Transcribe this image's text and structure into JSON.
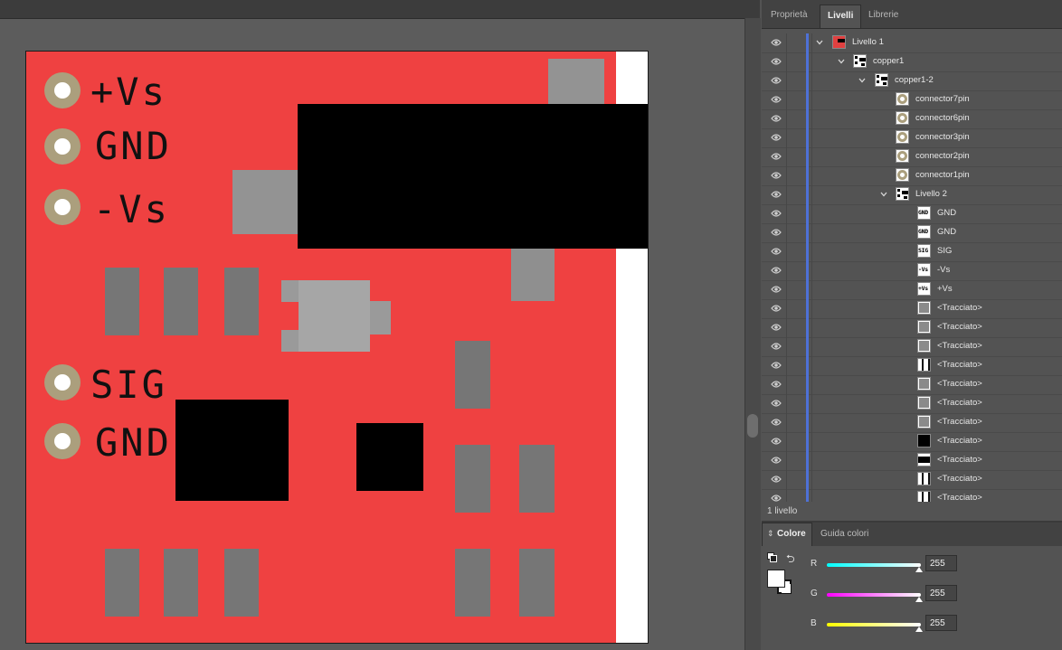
{
  "canvas": {
    "silkscreen_labels": [
      "+Vs",
      "GND",
      "-Vs",
      "SIG",
      "GND"
    ],
    "colors": {
      "board": "#ef4141",
      "pad": "#767676",
      "pad_light": "#939393",
      "ic": "#000000",
      "hole_ring": "#ab9f7d",
      "silk": "#111111"
    }
  },
  "panel": {
    "tabs": [
      "Proprietà",
      "Livelli",
      "Librerie"
    ],
    "active_tab": "Livelli",
    "layers": [
      {
        "name": "Livello 1",
        "icon": "artwork-thumb-red"
      },
      {
        "name": "copper1",
        "icon": "artwork-thumb"
      },
      {
        "name": "copper1-2",
        "icon": "artwork-thumb"
      },
      {
        "name": "connector7pin",
        "icon": "pin-thumb"
      },
      {
        "name": "connector6pin",
        "icon": "pin-thumb"
      },
      {
        "name": "connector3pin",
        "icon": "pin-thumb"
      },
      {
        "name": "connector2pin",
        "icon": "pin-thumb"
      },
      {
        "name": "connector1pin",
        "icon": "pin-thumb"
      },
      {
        "name": "Livello 2",
        "icon": "artwork-thumb"
      },
      {
        "name": "GND",
        "icon": "text-thumb",
        "thumb_text": "GND"
      },
      {
        "name": "GND",
        "icon": "text-thumb",
        "thumb_text": "GND"
      },
      {
        "name": "SIG",
        "icon": "text-thumb",
        "thumb_text": "SIG"
      },
      {
        "name": "-Vs",
        "icon": "text-thumb",
        "thumb_text": "-Vs"
      },
      {
        "name": "+Vs",
        "icon": "text-thumb",
        "thumb_text": "+Vs"
      },
      {
        "name": "<Tracciato>",
        "icon": "path-thumb-grey"
      },
      {
        "name": "<Tracciato>",
        "icon": "path-thumb-grey"
      },
      {
        "name": "<Tracciato>",
        "icon": "path-thumb-grey"
      },
      {
        "name": "<Tracciato>",
        "icon": "path-thumb-bar"
      },
      {
        "name": "<Tracciato>",
        "icon": "path-thumb-grey"
      },
      {
        "name": "<Tracciato>",
        "icon": "path-thumb-grey"
      },
      {
        "name": "<Tracciato>",
        "icon": "path-thumb-grey"
      },
      {
        "name": "<Tracciato>",
        "icon": "path-thumb-black"
      },
      {
        "name": "<Tracciato>",
        "icon": "path-thumb-blackbar"
      },
      {
        "name": "<Tracciato>",
        "icon": "path-thumb-bar"
      },
      {
        "name": "<Tracciato>",
        "icon": "path-thumb-bar"
      }
    ],
    "layer_count": "1 livello",
    "color_tabs": [
      "Colore",
      "Guida colori"
    ],
    "channels": [
      {
        "label": "R",
        "value": "255",
        "gradient": "linear-gradient(to right,#00ffff,#ffffff)"
      },
      {
        "label": "G",
        "value": "255",
        "gradient": "linear-gradient(to right,#ff00ff,#ffffff)"
      },
      {
        "label": "B",
        "value": "255",
        "gradient": "linear-gradient(to right,#ffff00,#ffffff)"
      }
    ],
    "fill_color": "#ffffff"
  }
}
